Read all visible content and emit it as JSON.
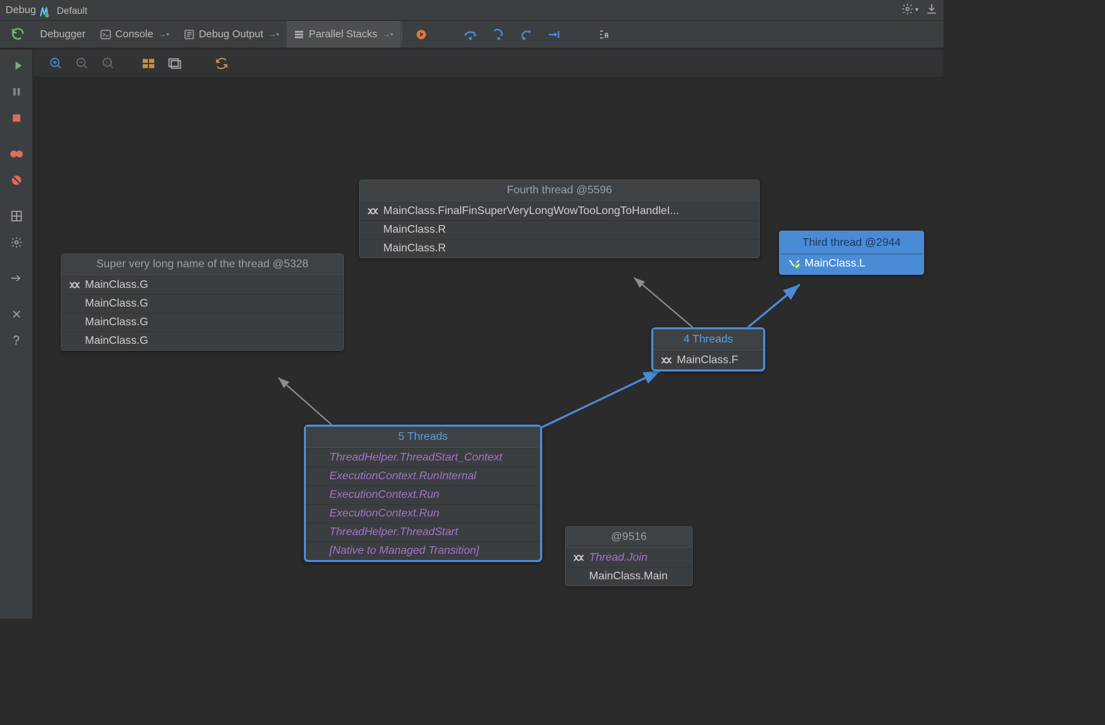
{
  "titlebar": {
    "label": "Debug",
    "config": "Default"
  },
  "tabs": {
    "debugger": "Debugger",
    "console": "Console",
    "debugOutput": "Debug Output",
    "parallelStacks": "Parallel Stacks"
  },
  "nodes": {
    "longThread": {
      "title": "Super very long name of the thread @5328",
      "frames": [
        "MainClass.G",
        "MainClass.G",
        "MainClass.G",
        "MainClass.G"
      ]
    },
    "fourth": {
      "title": "Fourth thread @5596",
      "frame0": "MainClass.FinalFinSuperVeryLongWowTooLongToHandleI...",
      "frame1": "MainClass.R",
      "frame2": "MainClass.R"
    },
    "third": {
      "title": "Third thread @2944",
      "frame0": "MainClass.L"
    },
    "four": {
      "title": "4 Threads",
      "frame0": "MainClass.F"
    },
    "five": {
      "title": "5 Threads",
      "frames": [
        "ThreadHelper.ThreadStart_Context",
        "ExecutionContext.RunInternal",
        "ExecutionContext.Run",
        "ExecutionContext.Run",
        "ThreadHelper.ThreadStart",
        "[Native to Managed Transition]"
      ]
    },
    "anon": {
      "title": "@9516",
      "frame0": "Thread.Join",
      "frame1": "MainClass.Main"
    }
  }
}
